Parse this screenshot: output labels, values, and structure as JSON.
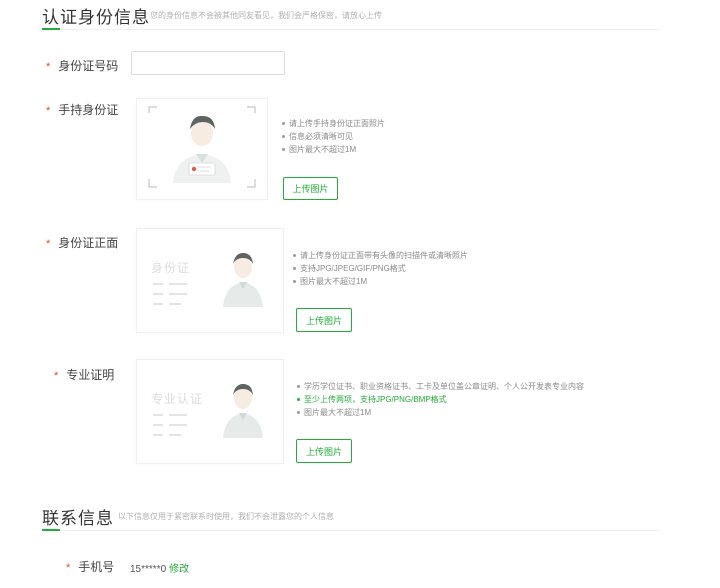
{
  "auth_section": {
    "title": "认证身份信息",
    "subtitle": "您的身份信息不会被其他同友看见，我们会严格保密，请放心上传",
    "id_number": {
      "label": "身份证号码",
      "value": "",
      "placeholder": ""
    },
    "handheld": {
      "label": "手持身份证",
      "tips": [
        "请上传手持身份证正面照片",
        "信息必须清晰可见",
        "图片最大不超过1M"
      ],
      "upload_label": "上传图片"
    },
    "id_front": {
      "label": "身份证正面",
      "card_text": "身份证",
      "tips": [
        "请上传身份证正面带有头像的扫描件或清晰照片",
        "支持JPG/JPEG/GIF/PNG格式",
        "图片最大不超过1M"
      ],
      "upload_label": "上传图片"
    },
    "professional": {
      "label": "专业证明",
      "card_text": "专业认证",
      "tips": [
        "学历学位证书、职业资格证书、工卡及单位盖公章证明、个人公开发表专业内容",
        "至少上传两项，支持JPG/PNG/BMP格式",
        "图片最大不超过1M"
      ],
      "upload_label": "上传图片"
    }
  },
  "contact_section": {
    "title": "联系信息",
    "subtitle": "以下信息仅用于紧密联系时使用，我们不会泄露您的个人信息",
    "phone": {
      "label": "手机号",
      "value": "15*****0",
      "edit_label": "修改"
    }
  },
  "colors": {
    "accent": "#22ac38",
    "required": "#e8442c"
  },
  "icons": {
    "person": "person-silhouette-icon",
    "card_lines": "card-lines-icon"
  }
}
